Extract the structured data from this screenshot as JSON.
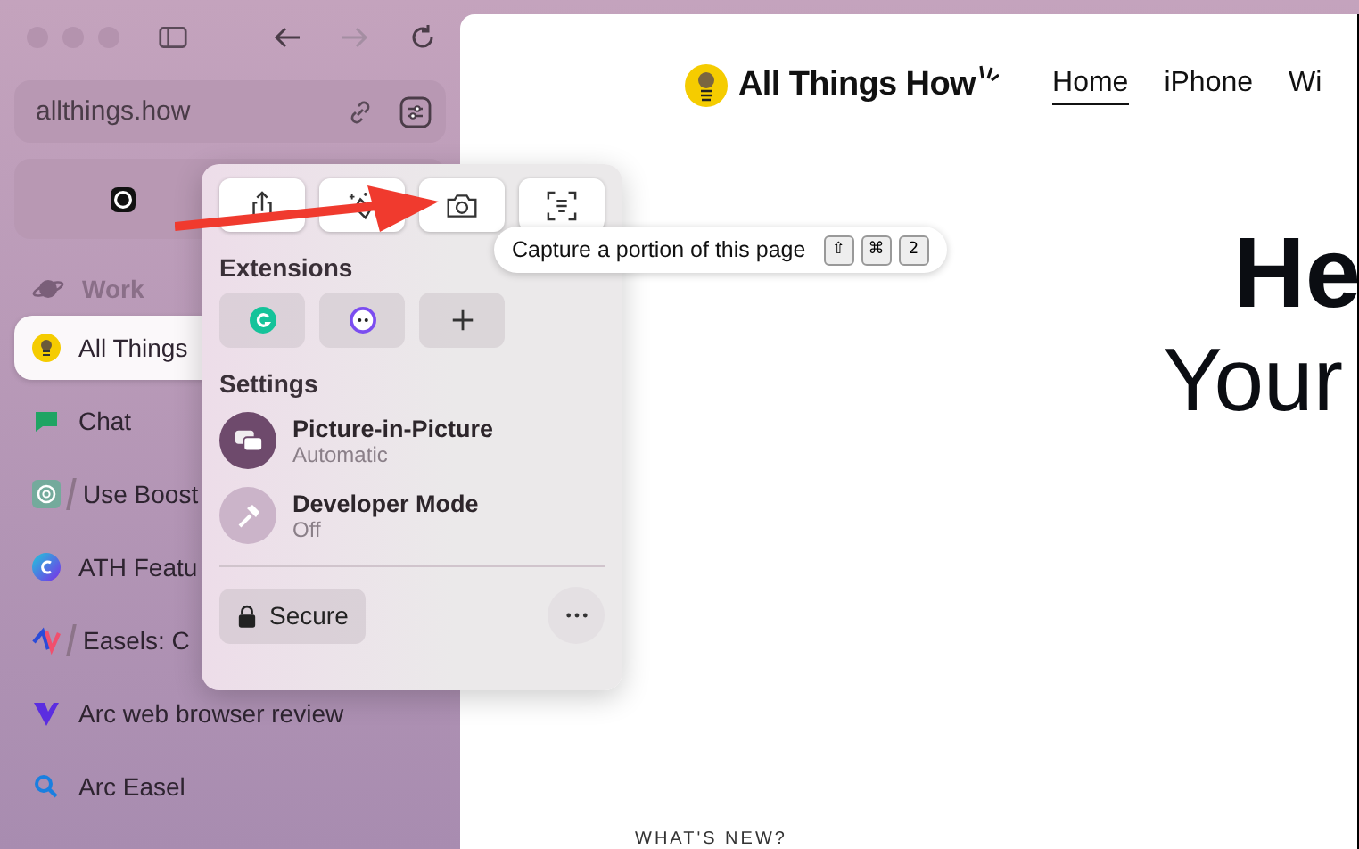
{
  "sidebar": {
    "url": "allthings.how",
    "space": "Work",
    "tabs": [
      {
        "title": "All Things",
        "kind": "bulb",
        "split": false,
        "selected": true
      },
      {
        "title": "Chat",
        "kind": "chat",
        "split": false,
        "selected": false
      },
      {
        "title": "Use Boost",
        "kind": "knot",
        "split": true,
        "selected": false
      },
      {
        "title": "ATH Featu",
        "kind": "canva",
        "split": false,
        "selected": false
      },
      {
        "title": "Easels: C",
        "kind": "easel",
        "split": true,
        "selected": false
      },
      {
        "title": "Arc web browser review",
        "kind": "arc",
        "split": false,
        "selected": false
      },
      {
        "title": "Arc Easel",
        "kind": "search",
        "split": false,
        "selected": false
      }
    ]
  },
  "popup": {
    "actions": [
      {
        "kind": "share"
      },
      {
        "kind": "brush"
      },
      {
        "kind": "camera"
      },
      {
        "kind": "capture"
      }
    ],
    "extensions_title": "Extensions",
    "extensions": [
      {
        "kind": "grammarly"
      },
      {
        "kind": "ghost"
      },
      {
        "kind": "add"
      }
    ],
    "settings_title": "Settings",
    "settings": [
      {
        "kind": "pip",
        "title": "Picture-in-Picture",
        "subtitle": "Automatic",
        "on": true
      },
      {
        "kind": "dev",
        "title": "Developer Mode",
        "subtitle": "Off",
        "on": false
      }
    ],
    "secure": "Secure"
  },
  "tooltip": {
    "text": "Capture a portion of this page",
    "keys": [
      "⇧",
      "⌘",
      "2"
    ]
  },
  "page": {
    "logo": "All Things How",
    "nav": [
      {
        "label": "Home",
        "selected": true
      },
      {
        "label": "iPhone",
        "selected": false
      },
      {
        "label": "Wi",
        "selected": false
      }
    ],
    "heading": "He",
    "subheading": "Your",
    "section": "WHAT'S NEW?"
  }
}
